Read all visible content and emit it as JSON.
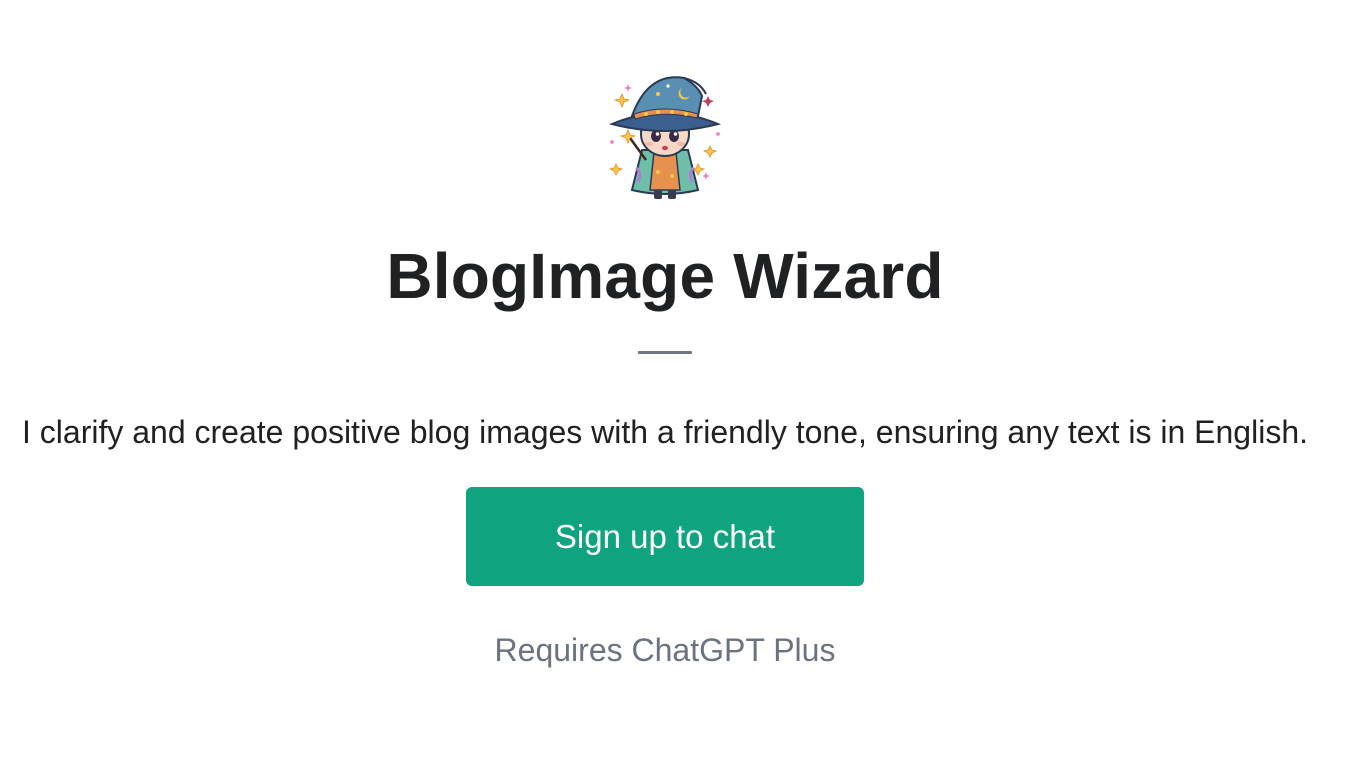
{
  "gpt": {
    "avatar_icon": "wizard-avatar-icon",
    "name": "BlogImage Wizard",
    "description": "I clarify and create positive blog images with a friendly tone, ensuring any text is in English."
  },
  "actions": {
    "signup_label": "Sign up to chat"
  },
  "footer": {
    "requirement_text": "Requires ChatGPT Plus"
  },
  "colors": {
    "accent": "#10a37f",
    "title_text": "#202123",
    "muted_text": "#6b7280",
    "background": "#ffffff"
  }
}
